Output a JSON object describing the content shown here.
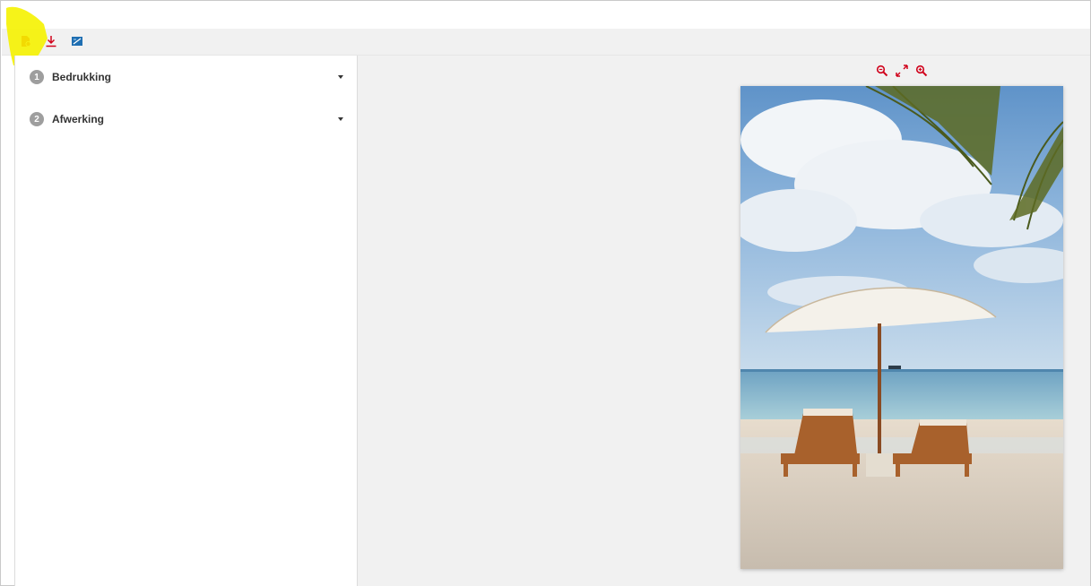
{
  "toolbar": {
    "icons": [
      "pdf-file-icon",
      "download-icon",
      "image-preview-icon"
    ],
    "accent_red": "#d0021b",
    "accent_blue": "#1f6fb2"
  },
  "steps": [
    {
      "number": "1",
      "label": "Bedrukking"
    },
    {
      "number": "2",
      "label": "Afwerking"
    }
  ],
  "viewer": {
    "tools": [
      "zoom-out-icon",
      "fit-to-screen-icon",
      "zoom-in-icon"
    ]
  },
  "annotation_color": "#f5f200"
}
